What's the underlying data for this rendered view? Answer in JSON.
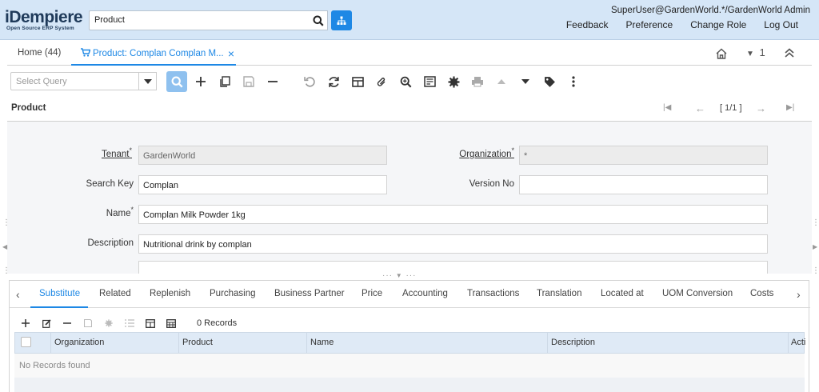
{
  "header": {
    "logo_text": "iDempiere",
    "logo_sub": "Open Source ERP System",
    "search_value": "Product",
    "user": "SuperUser@GardenWorld.*/GardenWorld Admin",
    "links": [
      "Feedback",
      "Preference",
      "Change Role",
      "Log Out"
    ]
  },
  "tabs": {
    "home": "Home (44)",
    "active": "Product: Complan Complan M...",
    "window_count": "1"
  },
  "toolbar": {
    "select_query_placeholder": "Select Query"
  },
  "panel": {
    "title": "Product",
    "pager": "[ 1/1 ]"
  },
  "form": {
    "tenant_label": "Tenant",
    "tenant_value": "GardenWorld",
    "org_label": "Organization",
    "org_value": "*",
    "search_key_label": "Search Key",
    "search_key_value": "Complan",
    "version_label": "Version No",
    "version_value": "",
    "name_label": "Name",
    "name_value": "Complan Milk Powder 1kg",
    "description_label": "Description",
    "description_value": "Nutritional drink by complan",
    "required_mark": "*"
  },
  "detail": {
    "tabs": [
      "Substitute",
      "Related",
      "Replenish",
      "Purchasing",
      "Business Partner",
      "Price",
      "Accounting",
      "Transactions",
      "Translation",
      "Located at",
      "UOM Conversion",
      "Costs"
    ],
    "records": "0 Records",
    "columns": [
      "Organization",
      "Product",
      "Name",
      "Description",
      "Acti"
    ],
    "empty": "No Records found"
  },
  "colors": {
    "accent": "#1e88e5",
    "header_bg": "#d5e6f7",
    "form_bg": "#f5f6f8"
  }
}
